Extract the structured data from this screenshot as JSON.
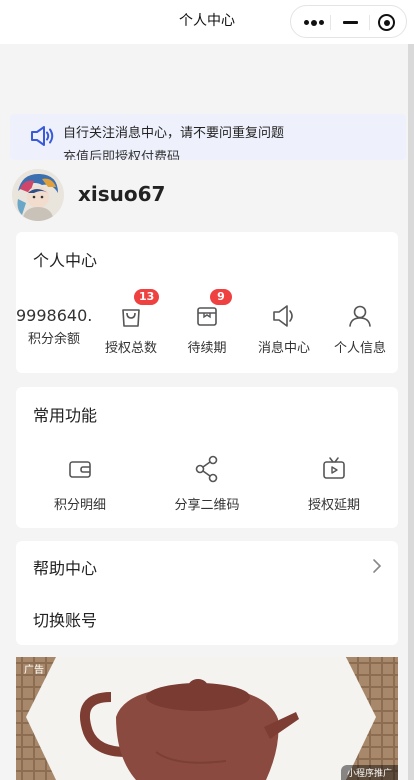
{
  "nav": {
    "title": "个人中心"
  },
  "notice": {
    "line1": "自行关注消息中心，请不要问重复问题",
    "line2": "充值后即授权付费码"
  },
  "user": {
    "name": "xisuo67"
  },
  "personal_center": {
    "title": "个人中心",
    "points_balance": {
      "value": "9998640.",
      "label": "积分余额"
    },
    "items": [
      {
        "label": "授权总数",
        "icon": "bag-icon",
        "badge": "13"
      },
      {
        "label": "待续期",
        "icon": "calendar-icon",
        "badge": "9"
      },
      {
        "label": "消息中心",
        "icon": "speaker-icon"
      },
      {
        "label": "个人信息",
        "icon": "user-icon"
      }
    ]
  },
  "functions": {
    "title": "常用功能",
    "items": [
      {
        "label": "积分明细",
        "icon": "wallet-icon"
      },
      {
        "label": "分享二维码",
        "icon": "share-icon"
      },
      {
        "label": "授权延期",
        "icon": "tv-icon"
      }
    ]
  },
  "help": {
    "help_center": "帮助中心",
    "switch_account": "切换账号"
  },
  "ad": {
    "tag": "广告",
    "footer": "小程序推广"
  },
  "colors": {
    "badge": "#f04141",
    "notice_bg": "#eef1fc",
    "notice_icon": "#3a5bd9"
  }
}
